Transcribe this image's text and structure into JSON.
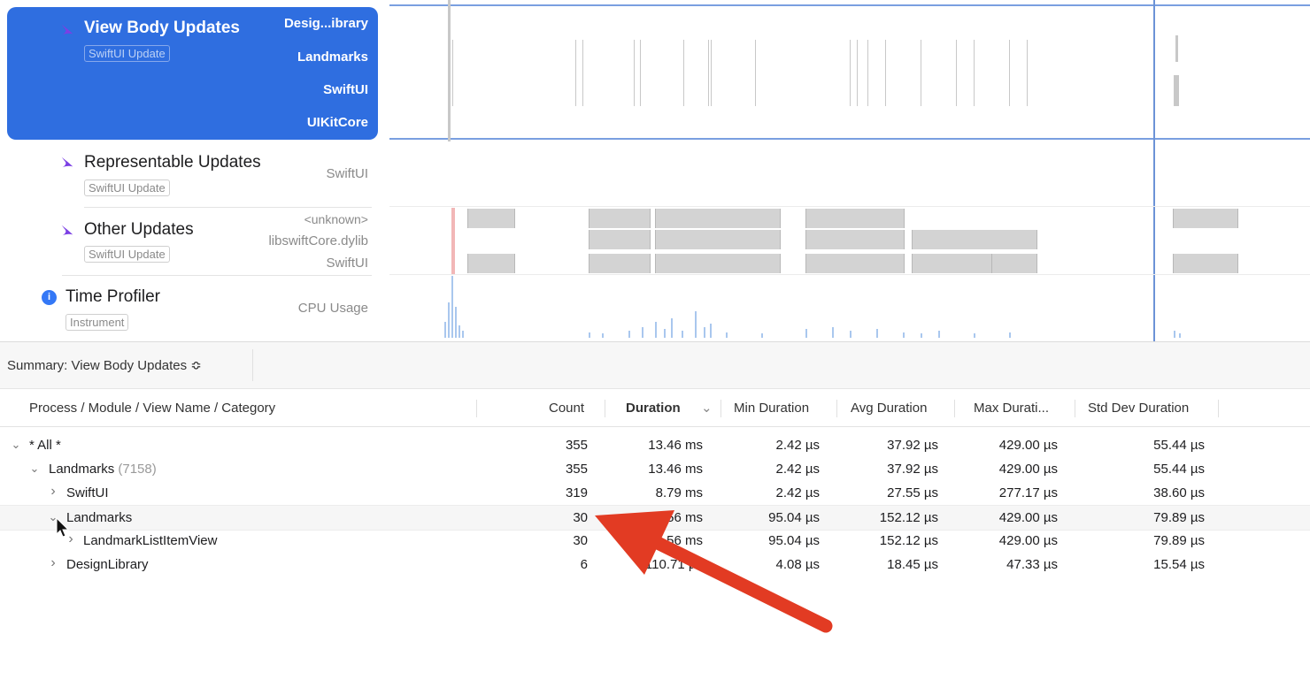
{
  "tracks": {
    "lanes": [
      {
        "name": "View Body Updates",
        "tag": "SwiftUI Update",
        "subs": [
          "Desig...ibrary",
          "Landmarks",
          "SwiftUI",
          "UIKitCore"
        ],
        "icon": "swift-icon"
      },
      {
        "name": "Representable Updates",
        "tag": "SwiftUI Update",
        "subs": [
          "SwiftUI"
        ],
        "icon": "swift-icon"
      },
      {
        "name": "Other Updates",
        "tag": "SwiftUI Update",
        "subs": [
          "<unknown>",
          "libswiftCore.dylib",
          "SwiftUI"
        ],
        "icon": "swift-icon"
      },
      {
        "name": "Time Profiler",
        "tag": "Instrument",
        "subs": [
          "CPU Usage"
        ],
        "icon": "info-icon"
      }
    ],
    "info_glyph": "i"
  },
  "summary": {
    "label": "Summary: View Body Updates ≎"
  },
  "table": {
    "columns": [
      "Process / Module / View Name / Category",
      "Count",
      "Duration",
      "Min Duration",
      "Avg Duration",
      "Max Durati...",
      "Std Dev Duration"
    ],
    "sort_indicator": "⌄",
    "rows": [
      {
        "disclosure": "⌄",
        "name": "* All *",
        "pid": "",
        "count": "355",
        "duration": "13.46 ms",
        "min": "2.42 µs",
        "avg": "37.92 µs",
        "max": "429.00 µs",
        "std": "55.44 µs"
      },
      {
        "disclosure": "⌄",
        "name": "Landmarks",
        "pid": "(7158)",
        "count": "355",
        "duration": "13.46 ms",
        "min": "2.42 µs",
        "avg": "37.92 µs",
        "max": "429.00 µs",
        "std": "55.44 µs"
      },
      {
        "disclosure": "›",
        "name": "SwiftUI",
        "pid": "",
        "count": "319",
        "duration": "8.79 ms",
        "min": "2.42 µs",
        "avg": "27.55 µs",
        "max": "277.17 µs",
        "std": "38.60 µs"
      },
      {
        "disclosure": "⌄",
        "name": "Landmarks",
        "pid": "",
        "count": "30",
        "duration": "4.56 ms",
        "min": "95.04 µs",
        "avg": "152.12 µs",
        "max": "429.00 µs",
        "std": "79.89 µs"
      },
      {
        "disclosure": "›",
        "name": "LandmarkListItemView",
        "pid": "",
        "count": "30",
        "duration": "4.56 ms",
        "min": "95.04 µs",
        "avg": "152.12 µs",
        "max": "429.00 µs",
        "std": "79.89 µs"
      },
      {
        "disclosure": "›",
        "name": "DesignLibrary",
        "pid": "",
        "count": "6",
        "duration": "110.71 µs",
        "min": "4.08 µs",
        "avg": "18.45 µs",
        "max": "47.33 µs",
        "std": "15.54 µs"
      }
    ]
  },
  "colors": {
    "selection": "#2f6ee0",
    "annotation_arrow": "#e23b23",
    "swift_icon": "#7b3fe4"
  }
}
